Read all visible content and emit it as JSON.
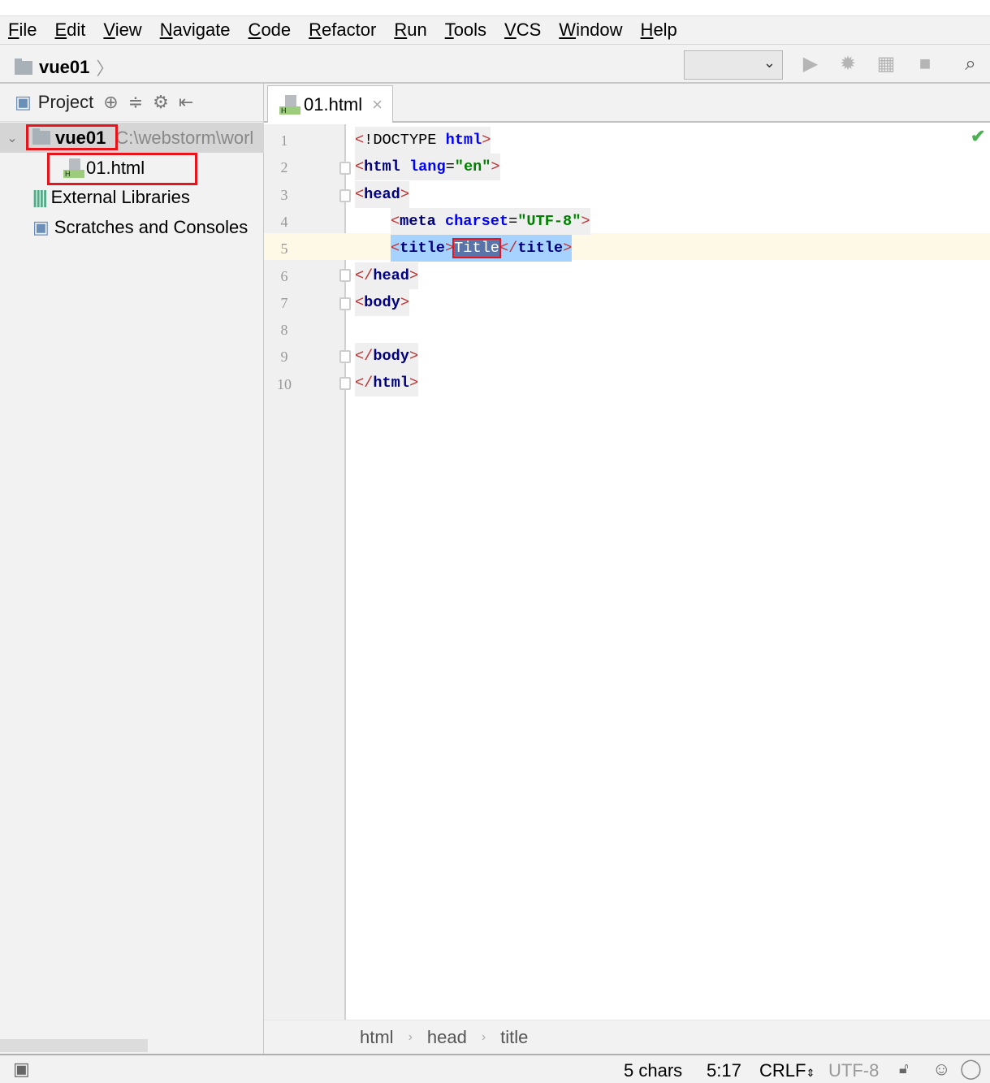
{
  "menu": [
    "File",
    "Edit",
    "View",
    "Navigate",
    "Code",
    "Refactor",
    "Run",
    "Tools",
    "VCS",
    "Window",
    "Help"
  ],
  "navbar": {
    "project": "vue01"
  },
  "project_panel": {
    "title": "Project",
    "root": {
      "name": "vue01",
      "path": "C:\\webstorm\\worl"
    },
    "file": "01.html",
    "external": "External Libraries",
    "scratches": "Scratches and Consoles"
  },
  "editor": {
    "tab": "01.html",
    "lines": [
      "1",
      "2",
      "3",
      "4",
      "5",
      "6",
      "7",
      "8",
      "9",
      "10"
    ],
    "selected_text": "Title"
  },
  "breadcrumb": [
    "html",
    "head",
    "title"
  ],
  "status": {
    "chars": "5 chars",
    "position": "5:17",
    "line_ending": "CRLF",
    "encoding": "UTF-8"
  }
}
